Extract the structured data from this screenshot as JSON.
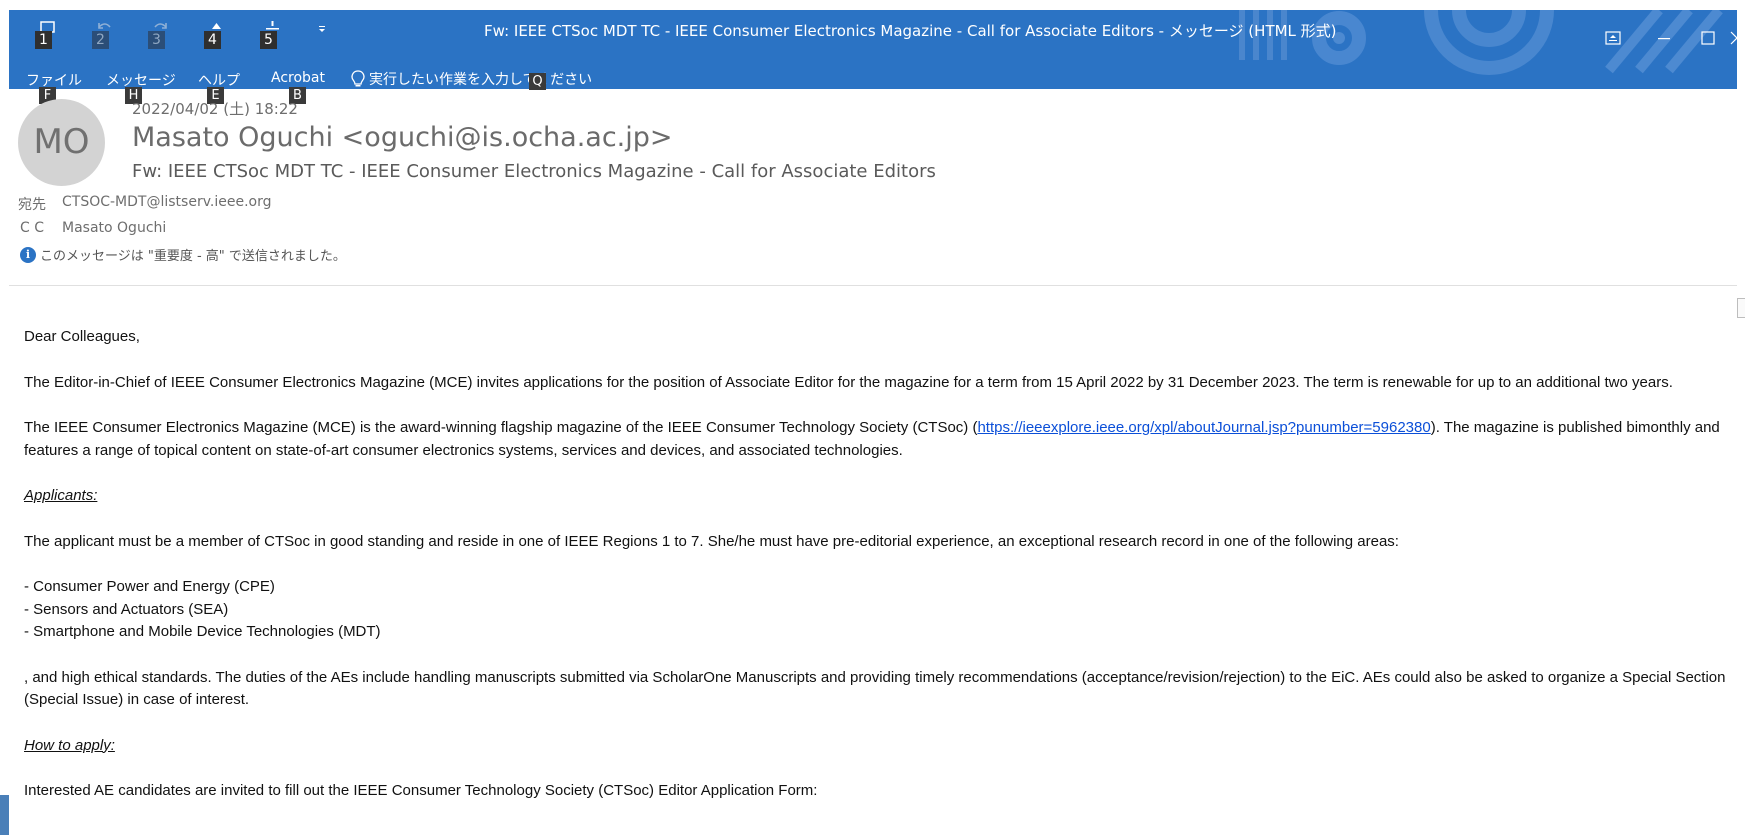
{
  "window": {
    "title": "Fw: IEEE CTSoc MDT TC - IEEE Consumer Electronics Magazine - Call for Associate Editors  -  メッセージ (HTML 形式)"
  },
  "quick_access": {
    "keys": [
      "1",
      "2",
      "3",
      "4",
      "5"
    ],
    "icons": [
      "save-icon",
      "undo-icon",
      "redo-icon",
      "up-arrow-icon",
      "down-arrow-icon"
    ]
  },
  "ribbon": {
    "menus": [
      {
        "label": "ファイル",
        "key": "F"
      },
      {
        "label": "メッセージ",
        "key": "H"
      },
      {
        "label": "ヘルプ",
        "key": "E"
      },
      {
        "label": "Acrobat",
        "key": "B"
      }
    ],
    "tell_me": {
      "label": "実行したい作業を入力してください",
      "key": "Q"
    }
  },
  "header": {
    "avatar_initials": "MO",
    "datetime": "2022/04/02 (土) 18:22",
    "sender": "Masato Oguchi <oguchi@is.ocha.ac.jp>",
    "subject": "Fw: IEEE CTSoc MDT TC - IEEE Consumer Electronics Magazine - Call for Associate Editors",
    "to_label": "宛先",
    "to_value": "CTSOC-MDT@listserv.ieee.org",
    "cc_label": "C C",
    "cc_value": "Masato Oguchi",
    "importance_note": "このメッセージは \"重要度 - 高\" で送信されました。"
  },
  "body": {
    "greeting": "Dear Colleagues,",
    "para1": "The Editor-in-Chief of IEEE Consumer Electronics Magazine (MCE) invites applications for the position of Associate Editor for the magazine for a term from 15 April 2022 by 31 December 2023. The term is renewable for up to an additional two years.",
    "para2_before": "The IEEE Consumer Electronics Magazine (MCE) is the award-winning flagship magazine of the IEEE Consumer Technology Society (CTSoc) (",
    "para2_link": "https://ieeexplore.ieee.org/xpl/aboutJournal.jsp?punumber=5962380",
    "para2_after": "). The magazine is published bimonthly and features a range of topical content on state-of-art consumer electronics systems, services and devices, and associated technologies.",
    "applicants_heading": "Applicants:",
    "para3": "The applicant must be a member of CTSoc in good standing and reside in one of IEEE Regions 1 to 7. She/he must have pre-editorial experience, an exceptional research record in one of the following areas:",
    "areas": [
      "- Consumer Power and Energy (CPE)",
      "- Sensors and Actuators (SEA)",
      "- Smartphone and Mobile Device Technologies (MDT)"
    ],
    "para4": ", and high ethical standards. The duties of the AEs include handling manuscripts submitted via ScholarOne Manuscripts and providing timely recommendations (acceptance/revision/rejection) to the EiC. AEs could also be asked to organize a Special Section (Special Issue) in case of interest.",
    "howto_heading": "How to apply:",
    "para5": "Interested AE candidates are invited to fill out the IEEE Consumer Technology Society (CTSoc) Editor Application Form:"
  },
  "colors": {
    "titlebar": "#2b73c4",
    "link": "#0b4fd8",
    "avatar_bg": "#d3d3d3"
  }
}
